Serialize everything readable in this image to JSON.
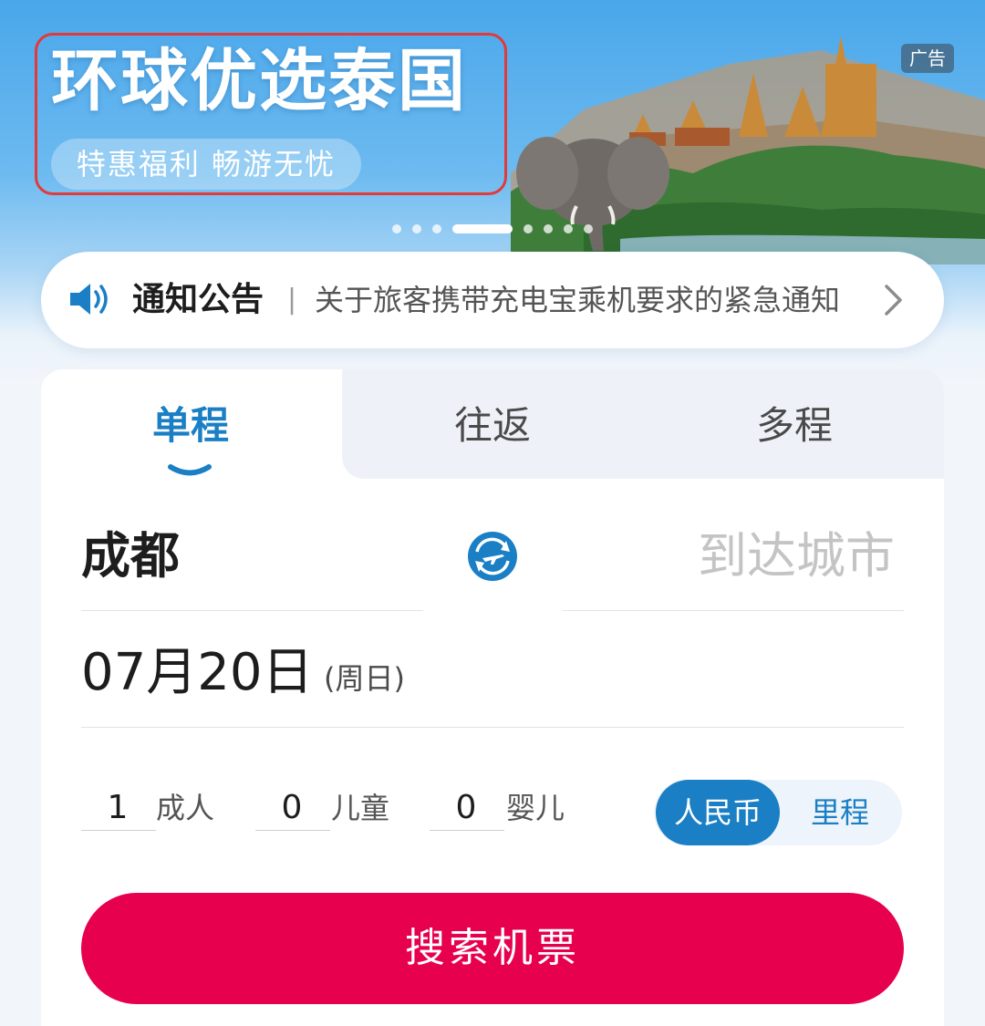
{
  "banner": {
    "title": "环球优选泰国",
    "subtitle": "特惠福利 畅游无忧",
    "ad_tag": "广告",
    "slide_count": 8,
    "active_slide": 4
  },
  "notice": {
    "label": "通知公告",
    "separator": "|",
    "text": "关于旅客携带充电宝乘机要求的紧急通知",
    "icon": "speaker-icon"
  },
  "tabs": [
    {
      "label": "单程",
      "active": true
    },
    {
      "label": "往返",
      "active": false
    },
    {
      "label": "多程",
      "active": false
    }
  ],
  "route": {
    "from_city": "成都",
    "to_placeholder": "到达城市",
    "swap_icon": "plane-swap-icon"
  },
  "date": {
    "value": "07月20日",
    "weekday": "(周日)"
  },
  "passengers": [
    {
      "count": "1",
      "label": "成人"
    },
    {
      "count": "0",
      "label": "儿童"
    },
    {
      "count": "0",
      "label": "婴儿"
    }
  ],
  "payment_toggle": {
    "selected": "人民币",
    "other": "里程"
  },
  "search_button": "搜索机票",
  "colors": {
    "accent_blue": "#1a7fc4",
    "search_red": "#e6004d",
    "banner_border": "#e23a3a"
  }
}
